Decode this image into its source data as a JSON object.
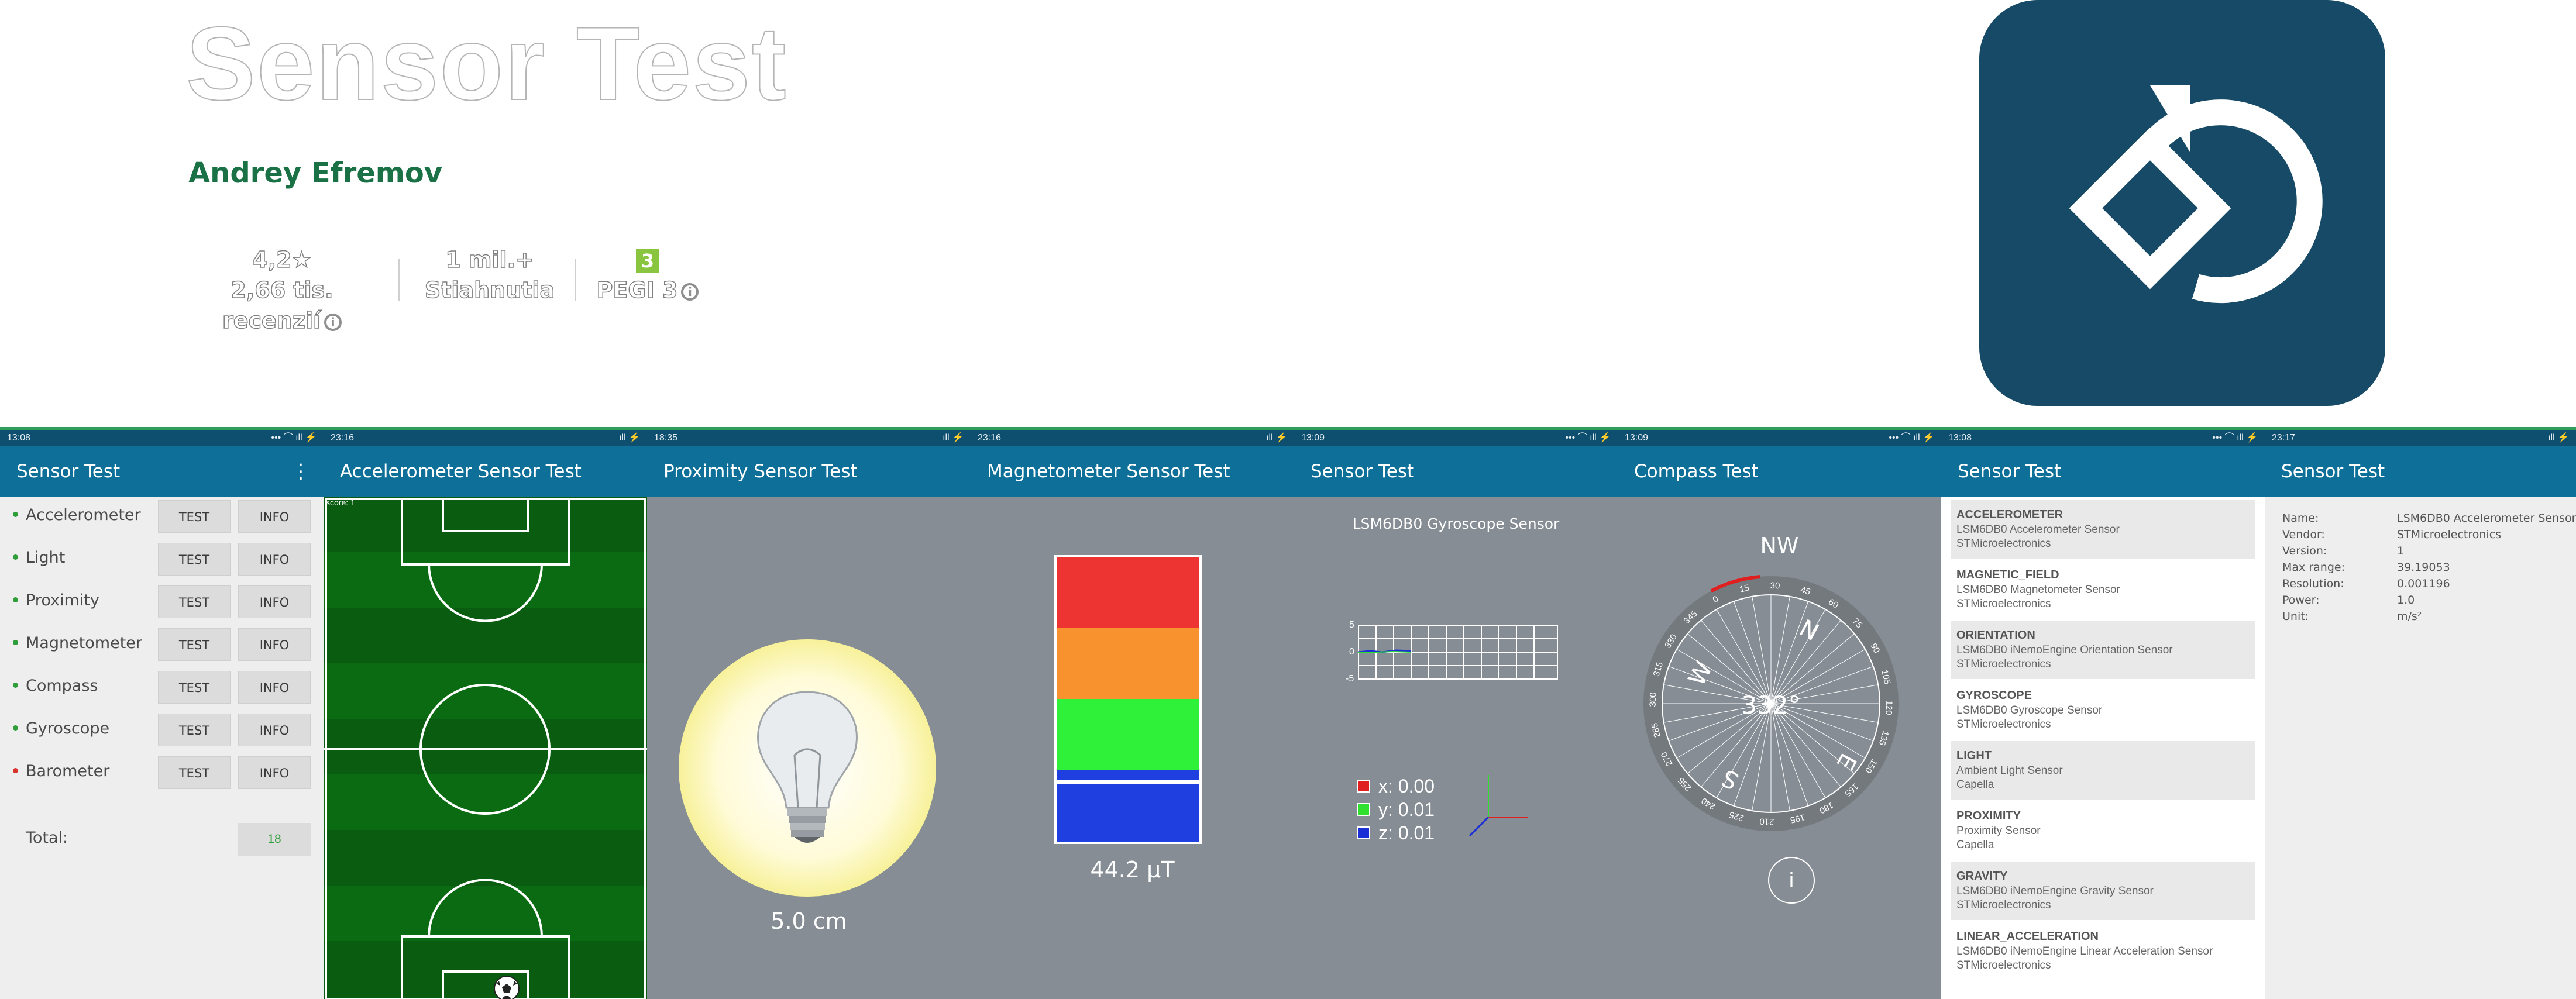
{
  "header": {
    "app_title": "Sensor Test",
    "developer": "Andrey Efremov",
    "rating_value": "4,2★",
    "rating_count": "2,66 tis. recenzií",
    "downloads_value": "1 mil.+",
    "downloads_label": "Stiahnutia",
    "pegi_badge": "3",
    "pegi_label": "PEGI 3",
    "info_glyph": "i"
  },
  "screens": {
    "status": {
      "s1_time": "13:08",
      "s2_time": "23:16",
      "s3_time": "18:35",
      "s4_time": "23:16",
      "s5_time": "13:09",
      "s6_time": "13:09",
      "s7_time": "13:08",
      "s8_time": "23:17",
      "icons_full": "••• ⌒ ıll ⚡",
      "icons_short": "ıll ⚡"
    },
    "list": {
      "title": "Sensor Test",
      "menu_icon": "⋮",
      "test_label": "TEST",
      "info_label": "INFO",
      "items": [
        {
          "name": "Accelerometer",
          "dot": "#2f9e3a"
        },
        {
          "name": "Light",
          "dot": "#2f9e3a"
        },
        {
          "name": "Proximity",
          "dot": "#2f9e3a"
        },
        {
          "name": "Magnetometer",
          "dot": "#2f9e3a"
        },
        {
          "name": "Compass",
          "dot": "#2f9e3a"
        },
        {
          "name": "Gyroscope",
          "dot": "#2f9e3a"
        },
        {
          "name": "Barometer",
          "dot": "#d9342b"
        }
      ],
      "total_label": "Total:",
      "total_value": "18"
    },
    "accelerometer": {
      "title": "Accelerometer Sensor Test",
      "score": "score: 1",
      "ball_icon": "soccer-ball"
    },
    "proximity": {
      "title": "Proximity Sensor Test",
      "value": "5.0 cm",
      "bulb_icon": "light-bulb"
    },
    "magnetometer": {
      "title": "Magnetometer Sensor Test",
      "value": "44.2 μT",
      "level_fraction": 0.13
    },
    "gyroscope": {
      "title": "Sensor Test",
      "sensor_name": "LSM6DB0 Gyroscope Sensor",
      "tick_top": "5",
      "tick_mid": "0",
      "tick_bot": "-5",
      "x_value": "x: 0.00",
      "y_value": "y: 0.01",
      "z_value": "z: 0.01",
      "x_color": "#e02020",
      "y_color": "#2fe02f",
      "z_color": "#1a2fd6"
    },
    "compass": {
      "title": "Compass Test",
      "direction": "NW",
      "heading": "332°",
      "n": "N",
      "e": "E",
      "s": "S",
      "w": "W",
      "info_icon": "i",
      "degree_labels": [
        "0",
        "15",
        "30",
        "45",
        "60",
        "75",
        "90",
        "105",
        "120",
        "135",
        "150",
        "165",
        "180",
        "195",
        "210",
        "225",
        "240",
        "255",
        "270",
        "285",
        "300",
        "315",
        "330",
        "345"
      ]
    },
    "sensor_list": {
      "title": "Sensor Test",
      "cards": [
        {
          "name": "ACCELEROMETER",
          "desc": "LSM6DB0 Accelerometer Sensor",
          "vendor": "STMicroelectronics"
        },
        {
          "name": "MAGNETIC_FIELD",
          "desc": "LSM6DB0 Magnetometer Sensor",
          "vendor": "STMicroelectronics"
        },
        {
          "name": "ORIENTATION",
          "desc": "LSM6DB0 iNemoEngine Orientation Sensor",
          "vendor": "STMicroelectronics"
        },
        {
          "name": "GYROSCOPE",
          "desc": "LSM6DB0 Gyroscope Sensor",
          "vendor": "STMicroelectronics"
        },
        {
          "name": "LIGHT",
          "desc": "Ambient Light Sensor",
          "vendor": "Capella"
        },
        {
          "name": "PROXIMITY",
          "desc": "Proximity Sensor",
          "vendor": "Capella"
        },
        {
          "name": "GRAVITY",
          "desc": "LSM6DB0 iNemoEngine Gravity Sensor",
          "vendor": "STMicroelectronics"
        },
        {
          "name": "LINEAR_ACCELERATION",
          "desc": "LSM6DB0 iNemoEngine Linear Acceleration Sensor",
          "vendor": "STMicroelectronics"
        }
      ]
    },
    "sensor_info": {
      "title": "Sensor Test",
      "rows": [
        {
          "k": "Name:",
          "v": "LSM6DB0 Accelerometer Sensor"
        },
        {
          "k": "Vendor:",
          "v": "STMicroelectronics"
        },
        {
          "k": "Version:",
          "v": "1"
        },
        {
          "k": "Max range:",
          "v": "39.19053"
        },
        {
          "k": "Resolution:",
          "v": "0.001196"
        },
        {
          "k": "Power:",
          "v": "1.0"
        },
        {
          "k": "Unit:",
          "v": "m/s²"
        }
      ]
    }
  }
}
